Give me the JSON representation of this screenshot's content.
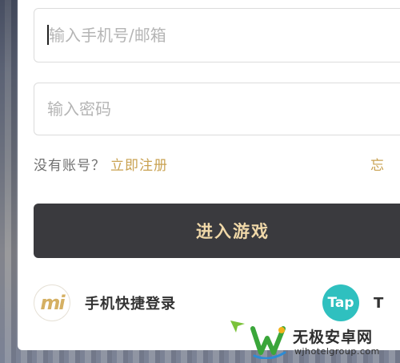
{
  "login": {
    "username_placeholder": "输入手机号/邮箱",
    "password_placeholder": "输入密码",
    "no_account_text": "没有账号？",
    "register_link": "立即注册",
    "forgot_partial": "忘",
    "enter_button": "进入游戏"
  },
  "alt_logins": [
    {
      "icon": "mi-logo-icon",
      "logo_text": "mi",
      "label": "手机快捷登录"
    },
    {
      "icon": "taptap-logo-icon",
      "logo_text": "Tap",
      "label": "T"
    }
  ],
  "watermark": {
    "title": "无极安卓网",
    "url": "wjhotelgroup.com"
  },
  "colors": {
    "accent_gold": "#c9a252",
    "button_dark": "#3a3a3e",
    "button_text": "#f0d8a8",
    "taptap_teal": "#2fc0bf"
  }
}
